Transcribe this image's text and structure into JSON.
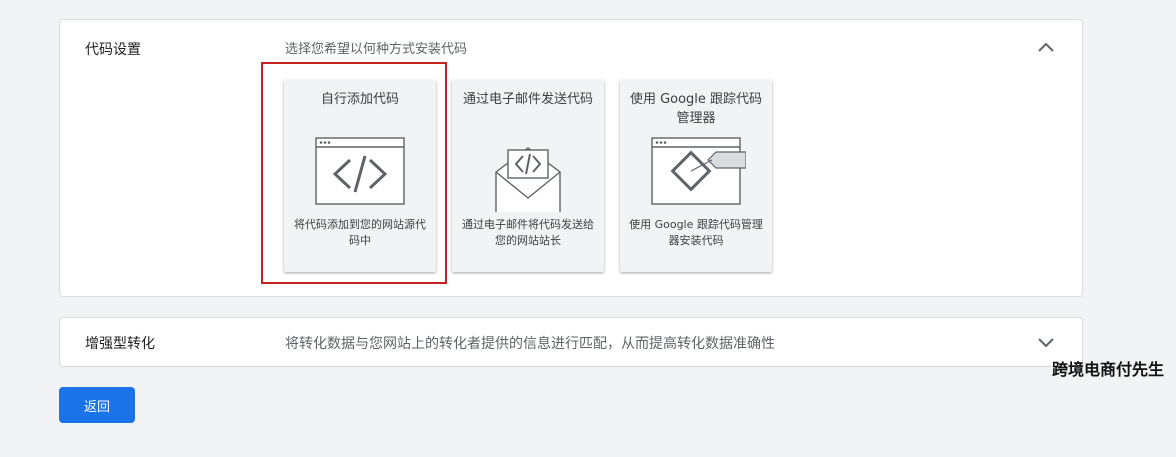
{
  "code_settings": {
    "title": "代码设置",
    "subtitle": "选择您希望以何种方式安装代码",
    "chevron_icon": "chevron-up-icon",
    "options": [
      {
        "title": "自行添加代码",
        "desc": "将代码添加到您的网站源代码中",
        "icon": "browser-code-icon"
      },
      {
        "title": "通过电子邮件发送代码",
        "desc": "通过电子邮件将代码发送给您的网站站长",
        "icon": "email-code-icon"
      },
      {
        "title": "使用 Google 跟踪代码管理器",
        "desc": "使用 Google 跟踪代码管理器安装代码",
        "icon": "tag-manager-icon"
      }
    ]
  },
  "enhanced_conversions": {
    "title": "增强型转化",
    "subtitle": "将转化数据与您网站上的转化者提供的信息进行匹配，从而提高转化数据准确性",
    "chevron_icon": "chevron-down-icon"
  },
  "back_button": {
    "label": "返回"
  },
  "watermark": "跨境电商付先生",
  "colors": {
    "primary": "#1a73e8",
    "highlight": "#c5221f",
    "card_bg": "#f1f3f4"
  }
}
